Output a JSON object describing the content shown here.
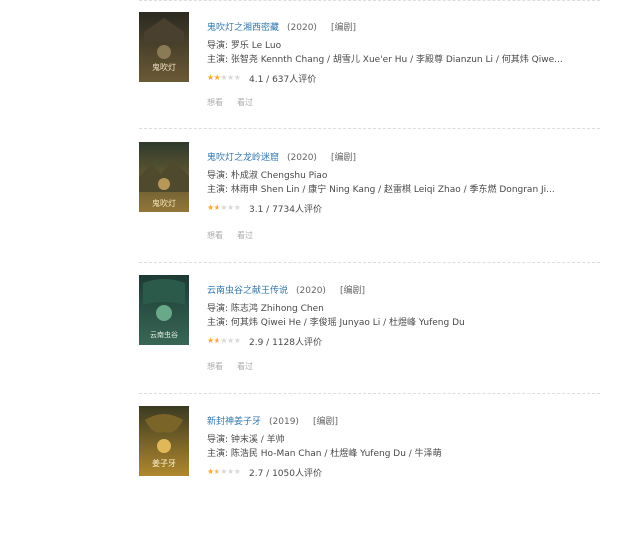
{
  "movies": [
    {
      "title": "鬼吹灯之湘西密藏",
      "year": "(2020)",
      "edit": "[编剧]",
      "director": "导演: 罗乐 Le Luo",
      "cast": "主演: 张智尧 Kennth Chang / 胡雪儿 Xue'er Hu / 李殿尊 Dianzun Li / 何其炜 Qiwe...",
      "rating_fraction": 0.41,
      "rating": "4.1 / 637人评价",
      "poster_text": "鬼吹灯",
      "poster_colors": [
        "#2b2a20",
        "#6b5a36"
      ]
    },
    {
      "title": "鬼吹灯之龙岭迷窟",
      "year": "(2020)",
      "edit": "[编剧]",
      "director": "导演: 朴成淑 Chengshu Piao",
      "cast": "主演: 林雨申 Shen Lin / 康宁 Ning Kang / 赵雷棋 Leiqi Zhao / 季东燃 Dongran Ji...",
      "rating_fraction": 0.31,
      "rating": "3.1 / 7734人评价",
      "poster_text": "鬼吹灯",
      "poster_colors": [
        "#2f3a2c",
        "#9a7a3a"
      ]
    },
    {
      "title": "云南虫谷之献王传说",
      "year": "(2020)",
      "edit": "[编剧]",
      "director": "导演: 陈志鸿 Zhihong Chen",
      "cast": "主演: 何其炜 Qiwei He / 李俊瑶 Junyao Li / 杜煜峰 Yufeng Du",
      "rating_fraction": 0.29,
      "rating": "2.9 / 1128人评价",
      "poster_text": "云南虫谷",
      "poster_colors": [
        "#1c3a34",
        "#3a6a58"
      ]
    },
    {
      "title": "新封神姜子牙",
      "year": "(2019)",
      "edit": "[编剧]",
      "director": "导演: 钟末溪 / 羊帅",
      "cast": "主演: 陈浩民 Ho-Man Chan / 杜煜峰 Yufeng Du / 牛泽萌",
      "rating_fraction": 0.27,
      "rating": "2.7 / 1050人评价",
      "poster_text": "姜子牙",
      "poster_colors": [
        "#3a3a22",
        "#b0882e"
      ]
    }
  ],
  "actions": {
    "want": "想看",
    "seen": "看过"
  },
  "star_glyphs": "★★★★★",
  "colors": {
    "link": "#3377aa",
    "star": "#ffac2d"
  }
}
